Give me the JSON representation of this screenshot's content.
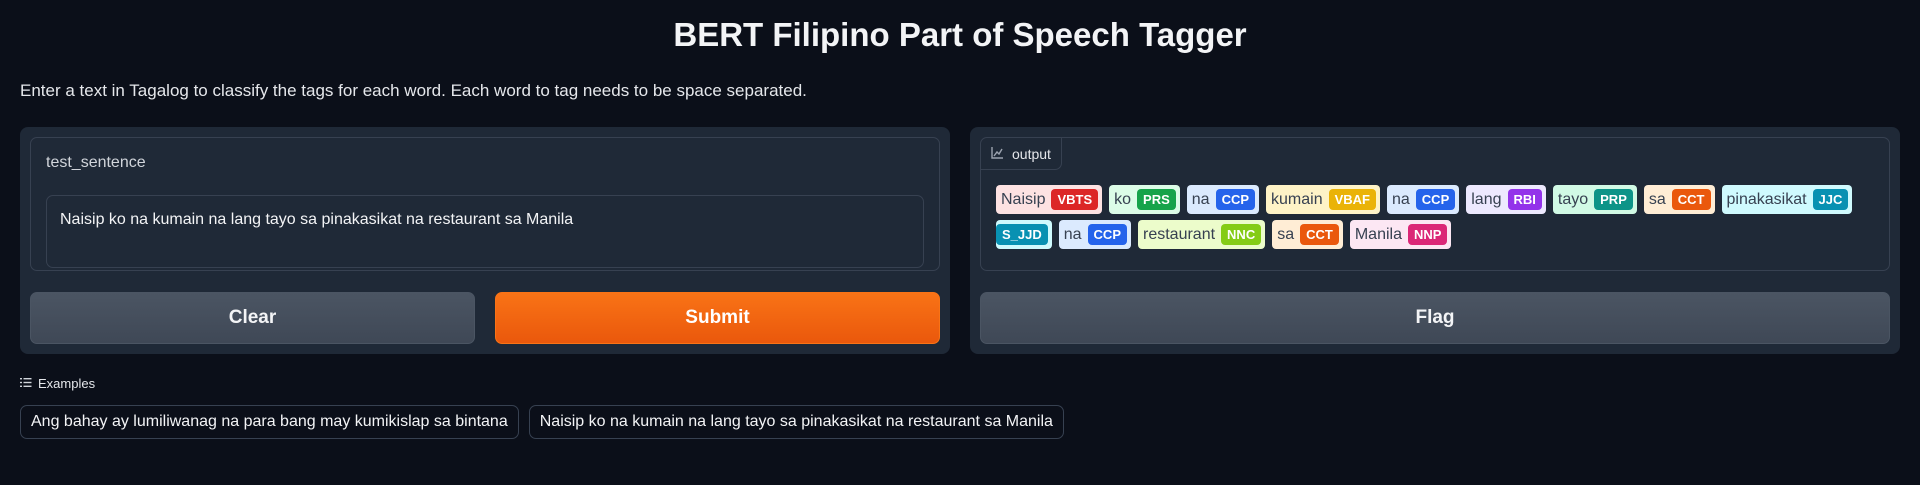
{
  "title": "BERT Filipino Part of Speech Tagger",
  "description": "Enter a text in Tagalog to classify the tags for each word. Each word to tag needs to be space separated.",
  "input": {
    "label": "test_sentence",
    "value": "Naisip ko na kumain na lang tayo sa pinakasikat na restaurant sa Manila"
  },
  "buttons": {
    "clear": "Clear",
    "submit": "Submit",
    "flag": "Flag"
  },
  "output": {
    "label": "output",
    "icon": "chart-icon",
    "chips": [
      {
        "word": "Naisip",
        "tag": "VBTS",
        "bg": "#fde2e2",
        "tagColor": "#dc2626"
      },
      {
        "word": "ko",
        "tag": "PRS",
        "bg": "#dcfce7",
        "tagColor": "#16a34a"
      },
      {
        "word": "na",
        "tag": "CCP",
        "bg": "#dbeafe",
        "tagColor": "#2563eb"
      },
      {
        "word": "kumain",
        "tag": "VBAF",
        "bg": "#fef3c7",
        "tagColor": "#eab308"
      },
      {
        "word": "na",
        "tag": "CCP",
        "bg": "#dbeafe",
        "tagColor": "#2563eb"
      },
      {
        "word": "lang",
        "tag": "RBI",
        "bg": "#ede9fe",
        "tagColor": "#9333ea"
      },
      {
        "word": "tayo",
        "tag": "PRP",
        "bg": "#d1fae5",
        "tagColor": "#0d9488"
      },
      {
        "word": "sa",
        "tag": "CCT",
        "bg": "#ffedd5",
        "tagColor": "#ea580c"
      },
      {
        "word": "pinakasikat",
        "tag": "JJC",
        "bg": "#cffafe",
        "tagColor": "#0891b2"
      },
      {
        "word": "",
        "tag": "S_JJD",
        "bg": "#cffafe",
        "tagColor": "#0891b2"
      },
      {
        "word": "na",
        "tag": "CCP",
        "bg": "#dbeafe",
        "tagColor": "#2563eb"
      },
      {
        "word": "restaurant",
        "tag": "NNC",
        "bg": "#ecfccb",
        "tagColor": "#84cc16"
      },
      {
        "word": "sa",
        "tag": "CCT",
        "bg": "#ffedd5",
        "tagColor": "#ea580c"
      },
      {
        "word": "Manila",
        "tag": "NNP",
        "bg": "#fce7f3",
        "tagColor": "#db2777"
      }
    ]
  },
  "examples": {
    "label": "Examples",
    "items": [
      "Ang bahay ay lumiliwanag na para bang may kumikislap sa bintana",
      "Naisip ko na kumain na lang tayo sa pinakasikat na restaurant sa Manila"
    ]
  }
}
